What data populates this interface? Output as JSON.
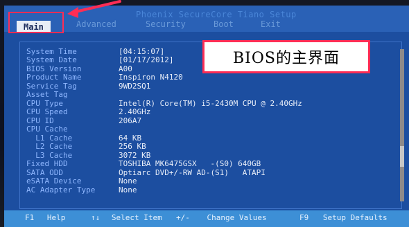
{
  "header": {
    "title": "Phoenix SecureCore Tiano Setup",
    "tabs": [
      {
        "label": "Main"
      },
      {
        "label": "Advanced"
      },
      {
        "label": "Security"
      },
      {
        "label": "Boot"
      },
      {
        "label": "Exit"
      }
    ]
  },
  "overlay": {
    "text": "BIOS的主界面"
  },
  "system": {
    "rows": [
      {
        "label": "System Time",
        "value": "[04:15:07]"
      },
      {
        "label": "System Date",
        "value": "[01/17/2012]"
      },
      {
        "label": "BIOS Version",
        "value": "A00"
      },
      {
        "label": "Product Name",
        "value": "Inspiron N4120"
      },
      {
        "label": "Service Tag",
        "value": "9WD2SQ1"
      },
      {
        "label": "Asset Tag",
        "value": ""
      },
      {
        "label": "CPU Type",
        "value": "Intel(R) Core(TM) i5-2430M CPU @ 2.40GHz"
      },
      {
        "label": "CPU Speed",
        "value": "2.40GHz"
      },
      {
        "label": "CPU ID",
        "value": "206A7"
      },
      {
        "label": "CPU Cache",
        "value": ""
      },
      {
        "label": "  L1 Cache",
        "value": "64 KB"
      },
      {
        "label": "  L2 Cache",
        "value": "256 KB"
      },
      {
        "label": "  L3 Cache",
        "value": "3072 KB"
      },
      {
        "label": "Fixed HDD",
        "value": "TOSHIBA MK6475GSX   -(S0) 640GB"
      },
      {
        "label": "SATA ODD",
        "value": "Optiarc DVD+/-RW AD-(S1)   ATAPI"
      },
      {
        "label": "eSATA Device",
        "value": "None"
      },
      {
        "label": "AC Adapter Type",
        "value": "None"
      }
    ]
  },
  "footer": {
    "items": [
      {
        "key": "F1",
        "text": "Help"
      },
      {
        "key": "↑↓",
        "text": "Select Item"
      },
      {
        "key": "+/-",
        "text": "Change Values"
      },
      {
        "key": "F9",
        "text": "Setup Defaults"
      }
    ]
  },
  "colors": {
    "bios_blue": "#1c4ea0",
    "highlight_red": "#ff2d55",
    "label_blue": "#8fb7ff"
  }
}
